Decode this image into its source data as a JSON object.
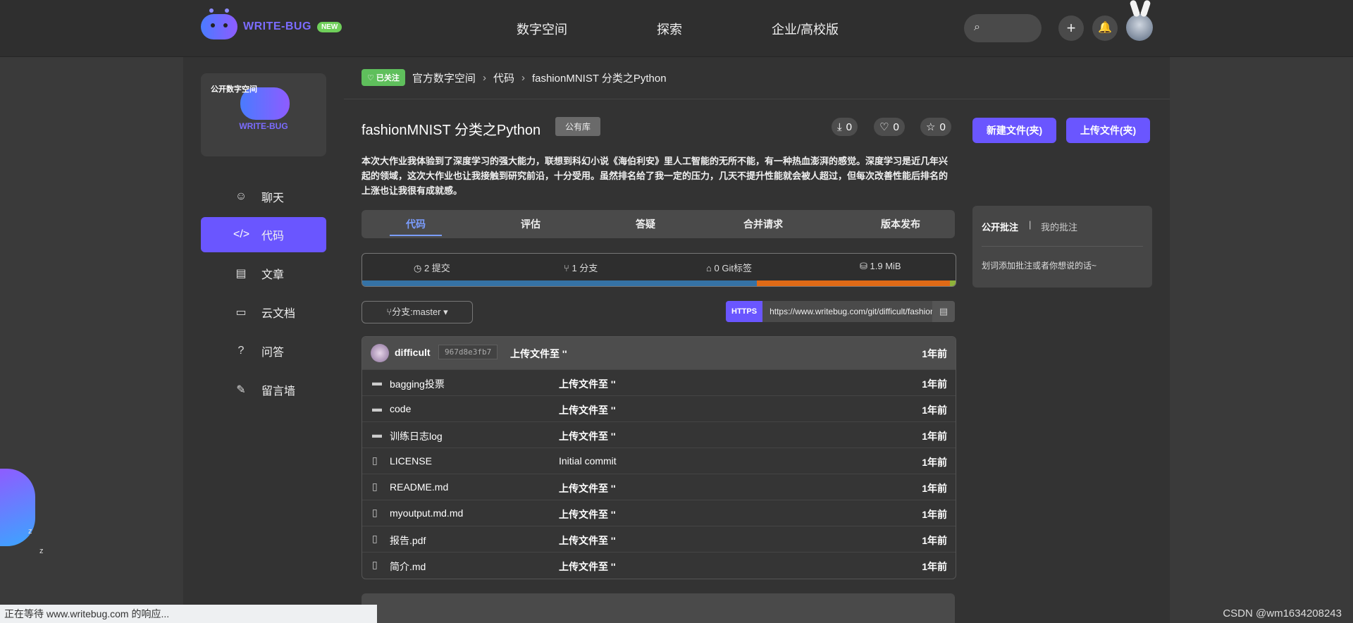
{
  "brand": {
    "name": "WRITE-BUG",
    "badge": "NEW"
  },
  "topnav": [
    "数字空间",
    "探索",
    "企业/高校版"
  ],
  "icons": {
    "search": "search-icon",
    "plus": "plus-icon",
    "bell": "bell-icon"
  },
  "space_card": {
    "label": "公开数字空间",
    "brand": "WRITE-BUG"
  },
  "sidebar": {
    "items": [
      {
        "label": "聊天",
        "icon": "☺",
        "active": false
      },
      {
        "label": "代码",
        "icon": "</>",
        "active": true
      },
      {
        "label": "文章",
        "icon": "▤",
        "active": false
      },
      {
        "label": "云文档",
        "icon": "▭",
        "active": false
      },
      {
        "label": "问答",
        "icon": "?",
        "active": false
      },
      {
        "label": "留言墙",
        "icon": "✎",
        "active": false
      }
    ]
  },
  "breadcrumb": {
    "follow": "已关注",
    "space": "官方数字空间",
    "section": "代码",
    "repo": "fashionMNIST 分类之Python"
  },
  "repo": {
    "title": "fashionMNIST 分类之Python",
    "visibility": "公有库",
    "downloads": "0",
    "likes": "0",
    "stars": "0",
    "new_file_button": "新建文件(夹)",
    "upload_button": "上传文件(夹)",
    "description": "本次大作业我体验到了深度学习的强大能力，联想到科幻小说《海伯利安》里人工智能的无所不能，有一种热血澎湃的感觉。深度学习是近几年兴起的领域，这次大作业也让我接触到研究前沿，十分受用。虽然排名给了我一定的压力，几天不提升性能就会被人超过，但每次改善性能后排名的上涨也让我很有成就感。"
  },
  "tabs": [
    "代码",
    "评估",
    "答疑",
    "合并请求",
    "版本发布"
  ],
  "stats": {
    "commits": "2 提交",
    "branches": "1 分支",
    "tags": "0 Git标签",
    "size": "1.9 MiB"
  },
  "languages": [
    {
      "color": "#3572a5",
      "share": 0.665
    },
    {
      "color": "#e06a16",
      "share": 0.325
    },
    {
      "color": "#8fb23a",
      "share": 0.01
    }
  ],
  "branch": {
    "label": "分支:master"
  },
  "clone": {
    "protocol": "HTTPS",
    "url": "https://www.writebug.com/git/difficult/fashionMNIST"
  },
  "latest_commit": {
    "user": "difficult",
    "hash": "967d8e3fb7",
    "message": "上传文件至 ''",
    "time": "1年前"
  },
  "files": [
    {
      "type": "folder",
      "name": "bagging投票",
      "message": "上传文件至 ''",
      "time": "1年前"
    },
    {
      "type": "folder",
      "name": "code",
      "message": "上传文件至 ''",
      "time": "1年前"
    },
    {
      "type": "folder",
      "name": "训练日志log",
      "message": "上传文件至 ''",
      "time": "1年前"
    },
    {
      "type": "file",
      "name": "LICENSE",
      "message": "Initial commit",
      "time": "1年前"
    },
    {
      "type": "file",
      "name": "README.md",
      "message": "上传文件至 ''",
      "time": "1年前"
    },
    {
      "type": "file",
      "name": "myoutput.md.md",
      "message": "上传文件至 ''",
      "time": "1年前"
    },
    {
      "type": "file",
      "name": "报告.pdf",
      "message": "上传文件至 ''",
      "time": "1年前"
    },
    {
      "type": "file",
      "name": "简介.md",
      "message": "上传文件至 ''",
      "time": "1年前"
    }
  ],
  "comments": {
    "tab_public": "公开批注",
    "tab_mine": "我的批注",
    "separator": "|",
    "placeholder": "划词添加批注或者你想说的话~"
  },
  "status_bar": "正在等待 www.writebug.com 的响应...",
  "watermark": "CSDN @wm1634208243"
}
